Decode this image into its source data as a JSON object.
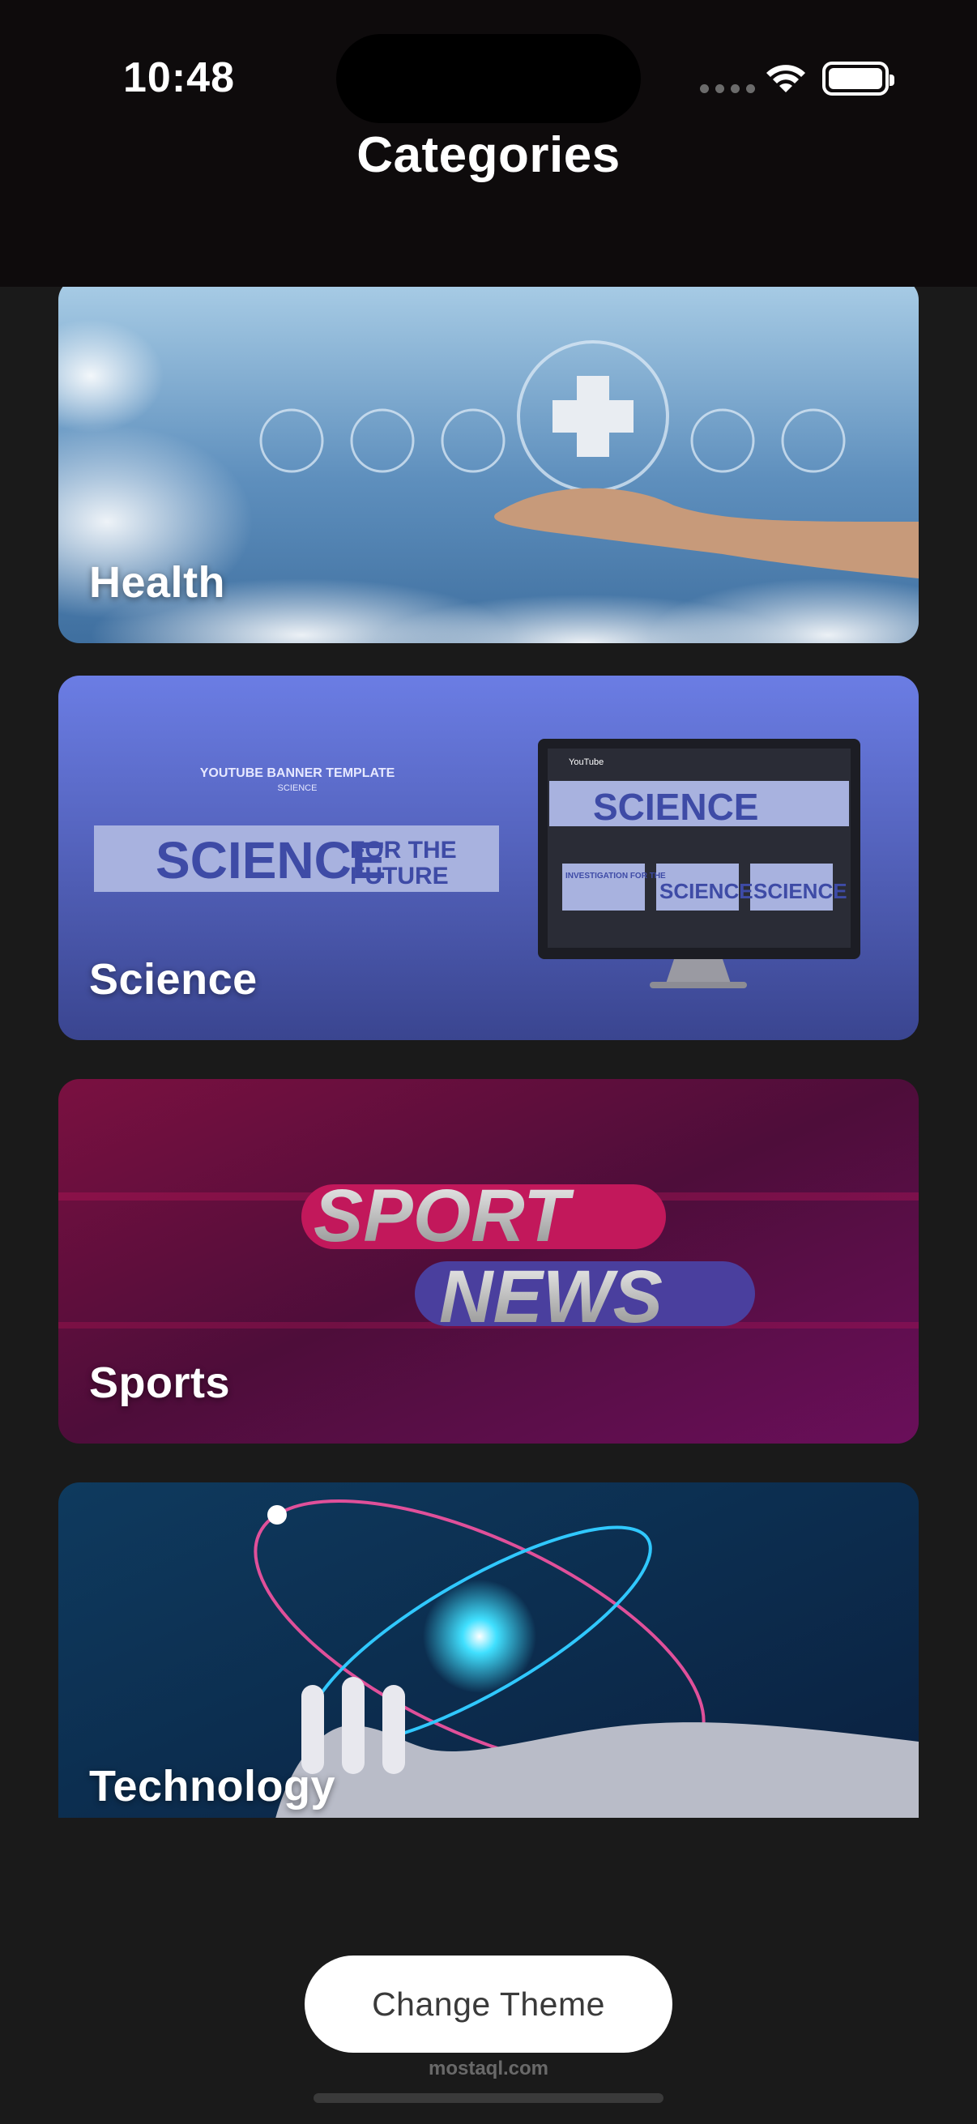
{
  "status_bar": {
    "time": "10:48"
  },
  "header": {
    "title": "Categories"
  },
  "categories": [
    {
      "label": "Health"
    },
    {
      "label": "Science"
    },
    {
      "label": "Sports"
    },
    {
      "label": "Technology"
    }
  ],
  "science_art": {
    "banner_small_title": "YOUTUBE BANNER TEMPLATE",
    "banner_small_sub": "SCIENCE",
    "banner_big": "SCIENCE",
    "banner_tag_1": "FOR THE",
    "banner_tag_2": "FUTURE",
    "screen_app": "YouTube",
    "thumb_1": "INVESTIGATION FOR THE",
    "thumb_2": "SCIENCE",
    "thumb_3": "SCIENCE"
  },
  "sports_art": {
    "line_1": "SPORT",
    "line_2": "NEWS"
  },
  "footer": {
    "theme_button": "Change Theme",
    "watermark": "mostaql.com"
  },
  "colors": {
    "background": "#1a1a1a",
    "header": "#0e0b0c",
    "button": "#ffffff"
  }
}
